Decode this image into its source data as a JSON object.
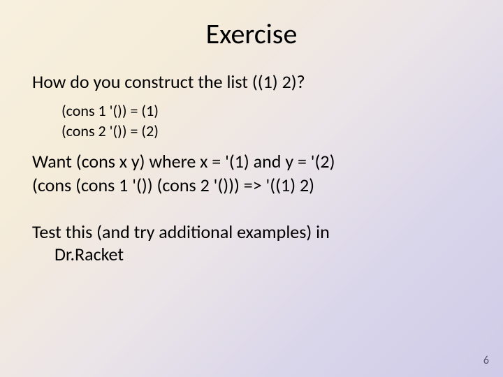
{
  "title": "Exercise",
  "question": "How do you construct the list ((1) 2)?",
  "sub1": "(cons 1 '()) = (1)",
  "sub2": "(cons 2 '()) = (2)",
  "want": "Want (cons x y) where x = '(1) and y = '(2)",
  "consline": "(cons (cons 1 '()) (cons 2 '())) => '((1) 2)",
  "test_line1": "Test this (and try additional examples) in",
  "test_line2": "Dr.Racket",
  "page_number": "6"
}
